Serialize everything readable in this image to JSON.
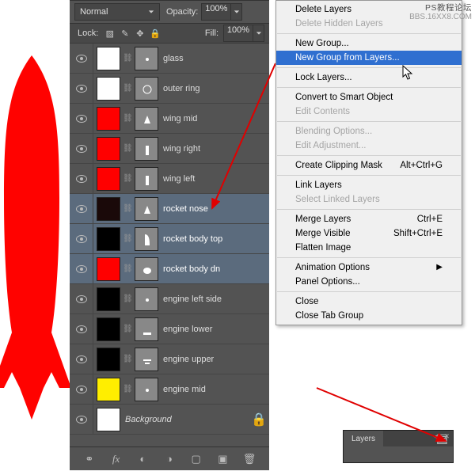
{
  "watermark_top": "PS教程论坛",
  "watermark_url": "BBS.16XX8.COM",
  "panel": {
    "blend_mode": "Normal",
    "opacity_label": "Opacity:",
    "opacity_value": "100%",
    "lock_label": "Lock:",
    "fill_label": "Fill:",
    "fill_value": "100%"
  },
  "layers": [
    {
      "name": "glass",
      "swatch": "#ffffff",
      "mask_icon": "dot",
      "selected": false
    },
    {
      "name": "outer ring",
      "swatch": "#ffffff",
      "mask_icon": "ring",
      "selected": false
    },
    {
      "name": "wing mid",
      "swatch": "#ff0000",
      "mask_icon": "tri",
      "selected": false
    },
    {
      "name": "wing right",
      "swatch": "#ff0000",
      "mask_icon": "bar",
      "selected": false
    },
    {
      "name": "wing left",
      "swatch": "#ff0000",
      "mask_icon": "bar",
      "selected": false
    },
    {
      "name": "rocket nose",
      "swatch": "#1a0909",
      "mask_icon": "tri",
      "selected": true
    },
    {
      "name": "rocket body top",
      "swatch": "#000000",
      "mask_icon": "body",
      "selected": true
    },
    {
      "name": "rocket body dn",
      "swatch": "#ff0000",
      "mask_icon": "blob",
      "selected": true
    },
    {
      "name": "engine left side",
      "swatch": "#000000",
      "mask_icon": "dot",
      "selected": false
    },
    {
      "name": "engine lower",
      "swatch": "#000000",
      "mask_icon": "line",
      "selected": false
    },
    {
      "name": "engine upper",
      "swatch": "#000000",
      "mask_icon": "line2",
      "selected": false
    },
    {
      "name": "engine mid",
      "swatch": "#ffee00",
      "mask_icon": "dot",
      "selected": false
    }
  ],
  "bg_layer": {
    "name": "Background",
    "swatch": "#ffffff"
  },
  "mini_panel": {
    "tab": "Layers"
  },
  "ctx": {
    "items": [
      {
        "label": "Delete Layers",
        "en": true
      },
      {
        "label": "Delete Hidden Layers",
        "en": false
      },
      {
        "sep": true
      },
      {
        "label": "New Group...",
        "en": true
      },
      {
        "label": "New Group from Layers...",
        "en": true,
        "hl": true
      },
      {
        "sep": true
      },
      {
        "label": "Lock Layers...",
        "en": true
      },
      {
        "sep": true
      },
      {
        "label": "Convert to Smart Object",
        "en": true
      },
      {
        "label": "Edit Contents",
        "en": false
      },
      {
        "sep": true
      },
      {
        "label": "Blending Options...",
        "en": false
      },
      {
        "label": "Edit Adjustment...",
        "en": false
      },
      {
        "sep": true
      },
      {
        "label": "Create Clipping Mask",
        "en": true,
        "sc": "Alt+Ctrl+G"
      },
      {
        "sep": true
      },
      {
        "label": "Link Layers",
        "en": true
      },
      {
        "label": "Select Linked Layers",
        "en": false
      },
      {
        "sep": true
      },
      {
        "label": "Merge Layers",
        "en": true,
        "sc": "Ctrl+E"
      },
      {
        "label": "Merge Visible",
        "en": true,
        "sc": "Shift+Ctrl+E"
      },
      {
        "label": "Flatten Image",
        "en": true
      },
      {
        "sep": true
      },
      {
        "label": "Animation Options",
        "en": true,
        "arrow": true
      },
      {
        "label": "Panel Options...",
        "en": true
      },
      {
        "sep": true
      },
      {
        "label": "Close",
        "en": true
      },
      {
        "label": "Close Tab Group",
        "en": true
      }
    ]
  }
}
